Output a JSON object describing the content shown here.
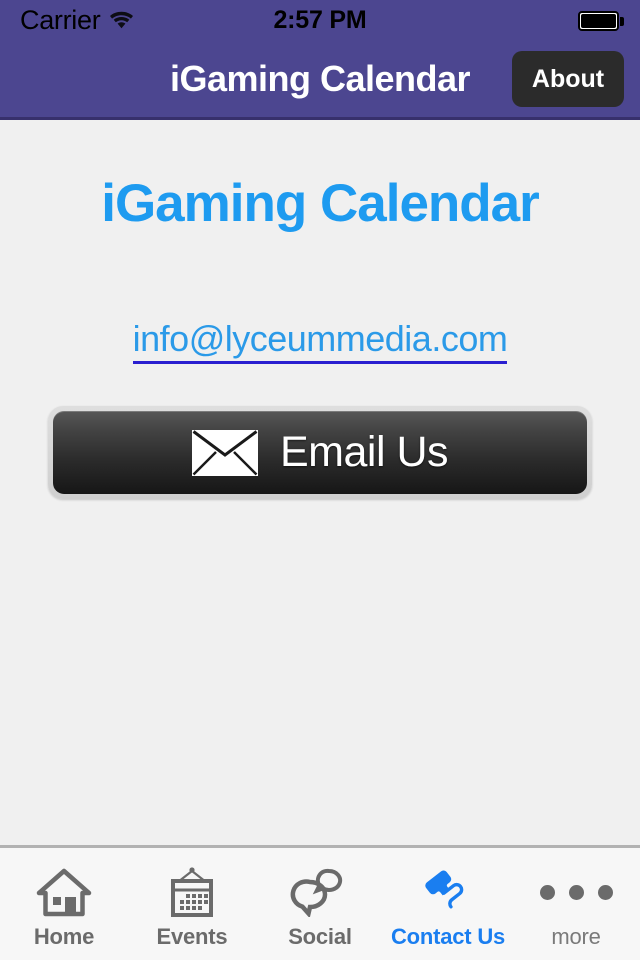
{
  "status_bar": {
    "carrier": "Carrier",
    "wifi_icon": "wifi-icon",
    "time": "2:57 PM",
    "battery_icon": "battery-full-icon"
  },
  "nav_bar": {
    "title": "iGaming Calendar",
    "about_label": "About",
    "background_color": "#4c4690"
  },
  "content": {
    "page_title": "iGaming Calendar",
    "page_title_color": "#1e9bf0",
    "email_address": "info@lyceummedia.com",
    "email_link_color": "#2b9ae8",
    "email_underline_color": "#2a1fd0",
    "email_button": {
      "label": "Email Us",
      "icon": "envelope-icon"
    }
  },
  "tab_bar": {
    "active_color": "#1a7ef0",
    "inactive_color": "#6b6b6b",
    "items": [
      {
        "label": "Home",
        "icon": "home-icon",
        "active": false
      },
      {
        "label": "Events",
        "icon": "calendar-icon",
        "active": false
      },
      {
        "label": "Social",
        "icon": "chat-bubbles-icon",
        "active": false
      },
      {
        "label": "Contact Us",
        "icon": "phone-handset-icon",
        "active": true
      },
      {
        "label": "more",
        "icon": "ellipsis-icon",
        "active": false
      }
    ]
  }
}
